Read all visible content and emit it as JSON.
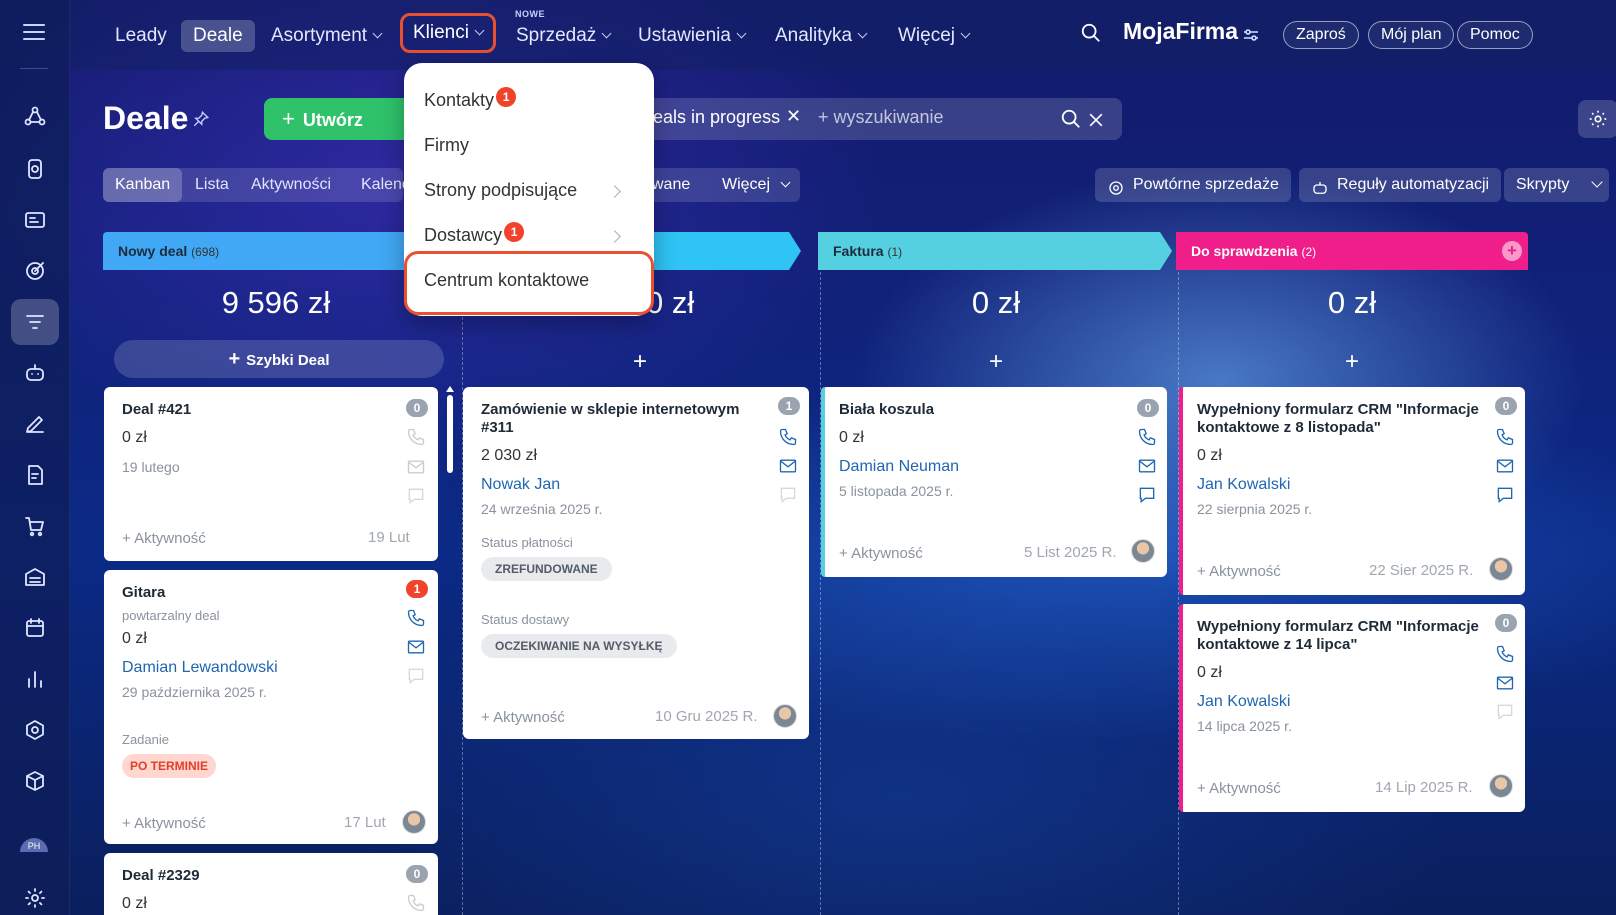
{
  "nav": {
    "items": [
      {
        "label": "Leady"
      },
      {
        "label": "Deale"
      },
      {
        "label": "Asortyment"
      },
      {
        "label": "Klienci"
      },
      {
        "label": "Sprzedaż"
      },
      {
        "label": "Ustawienia"
      },
      {
        "label": "Analityka"
      },
      {
        "label": "Więcej"
      }
    ],
    "new_badge": "NOWE",
    "brand": "MojaFirma",
    "buttons": {
      "invite": "Zaproś",
      "plan": "Mój plan",
      "help": "Pomoc"
    }
  },
  "rail": {
    "avatar_initials": "PH"
  },
  "toolbar": {
    "title": "Deale",
    "create": "Utwórz",
    "filter_tag": "Deals in progress",
    "search_placeholder": "+ wyszukiwanie"
  },
  "tabs": {
    "items": [
      "Kanban",
      "Lista",
      "Aktywności",
      "Kalendarz"
    ],
    "partial": "wane",
    "more": "Więcej",
    "tools": [
      "Powtórne sprzedaże",
      "Reguły automatyzacji",
      "Skrypty"
    ]
  },
  "dropdown": {
    "items": [
      {
        "label": "Kontakty",
        "badge": "1"
      },
      {
        "label": "Firmy"
      },
      {
        "label": "Strony podpisujące"
      },
      {
        "label": "Dostawcy",
        "badge": "1"
      },
      {
        "label": "Centrum kontaktowe"
      }
    ]
  },
  "columns": [
    {
      "name": "Nowy deal",
      "count": "(698)",
      "sum": "9 596 zł",
      "color": "#40a8f5",
      "quick": "Szybki Deal"
    },
    {
      "name": "",
      "count": "",
      "sum": "2 030 zł",
      "color": "#2fc4f4"
    },
    {
      "name": "Faktura",
      "count": "(1)",
      "sum": "0 zł",
      "color": "#55d0e0"
    },
    {
      "name": "Do sprawdzenia",
      "count": "(2)",
      "sum": "0 zł",
      "color": "#ef1e8a"
    }
  ],
  "cards": {
    "c1": {
      "title": "Deal #421",
      "badge": "0",
      "amount": "0 zł",
      "date": "19 lutego",
      "activity": "+ Aktywność",
      "short_date": "19 Lut"
    },
    "c2": {
      "title": "Gitara",
      "badge": "1",
      "subtitle": "powtarzalny deal",
      "amount": "0 zł",
      "contact": "Damian Lewandowski",
      "date": "29 października 2025 r.",
      "task_label": "Zadanie",
      "task_chip": "PO TERMINIE",
      "activity": "+ Aktywność",
      "short_date": "17 Lut"
    },
    "c3": {
      "title": "Deal #2329",
      "badge": "0",
      "amount": "0 zł"
    },
    "c4": {
      "title": "Zamówienie w sklepie internetowym #311",
      "badge": "1",
      "amount": "2 030 zł",
      "contact": "Nowak Jan",
      "date": "24 września 2025 r.",
      "pay_label": "Status płatności",
      "pay_chip": "ZREFUNDOWANE",
      "ship_label": "Status dostawy",
      "ship_chip": "OCZEKIWANIE NA WYSYŁKĘ",
      "activity": "+ Aktywność",
      "short_date": "10 Gru 2025 R."
    },
    "c5": {
      "title": "Biała koszula",
      "badge": "0",
      "amount": "0 zł",
      "contact": "Damian Neuman",
      "date": "5 listopada 2025 r.",
      "activity": "+ Aktywność",
      "short_date": "5 List 2025 R."
    },
    "c6": {
      "title": "Wypełniony formularz CRM \"Informacje kontaktowe z 8 listopada\"",
      "badge": "0",
      "amount": "0 zł",
      "contact": "Jan Kowalski",
      "date": "22 sierpnia 2025 r.",
      "activity": "+ Aktywność",
      "short_date": "22 Sier 2025 R."
    },
    "c7": {
      "title": "Wypełniony formularz CRM \"Informacje kontaktowe z 14 lipca\"",
      "badge": "0",
      "amount": "0 zł",
      "contact": "Jan Kowalski",
      "date": "14 lipca 2025 r.",
      "activity": "+ Aktywność",
      "short_date": "14 Lip 2025 R."
    }
  },
  "colors": {
    "accent_green": "#2fc26b",
    "highlight": "#e8502f",
    "badge_red": "#f0432b",
    "link": "#2067b0"
  }
}
